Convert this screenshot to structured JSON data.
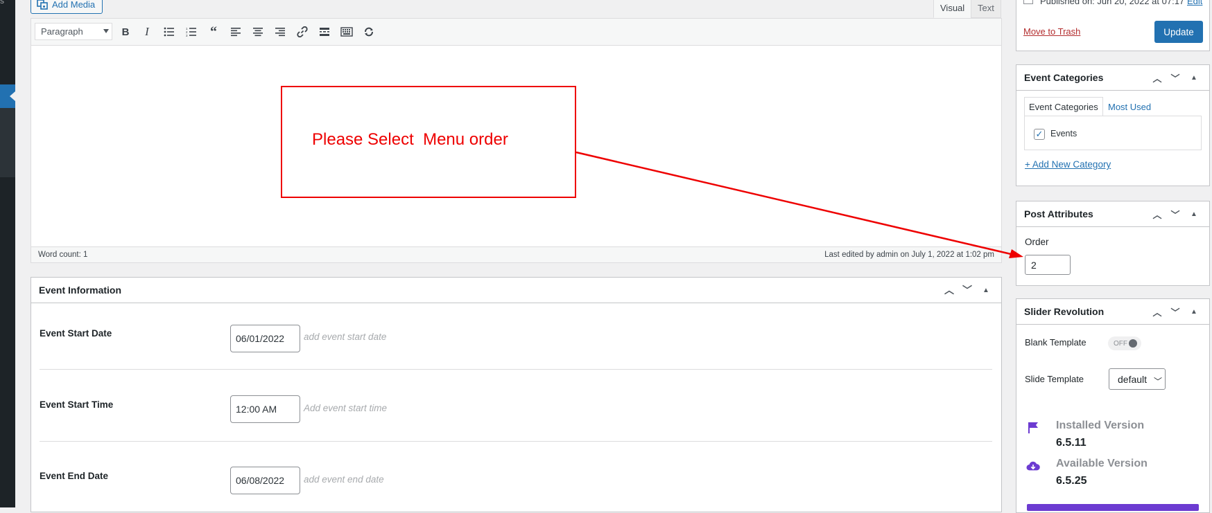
{
  "admin_menu": {
    "letter": "s"
  },
  "editor": {
    "add_media_label": "Add Media",
    "tabs": [
      {
        "label": "Visual"
      },
      {
        "label": "Text"
      }
    ],
    "format_select": "Paragraph",
    "toolbar_icons": [
      "bold-icon",
      "italic-icon",
      "bulleted-list-icon",
      "numbered-list-icon",
      "blockquote-icon",
      "align-left-icon",
      "align-center-icon",
      "align-right-icon",
      "link-icon",
      "read-more-icon",
      "toolbar-toggle-icon",
      "revisions-icon"
    ],
    "word_count": "Word count: 1",
    "last_edited": "Last edited by admin on July 1, 2022 at 1:02 pm"
  },
  "annotation": {
    "text": "Please Select  Menu order",
    "color": "#ff0000"
  },
  "event_info": {
    "title": "Event Information",
    "rows": [
      {
        "label": "Event Start Date",
        "value": "06/01/2022",
        "hint": "add event start date"
      },
      {
        "label": "Event Start Time",
        "value": "12:00 AM",
        "hint": "Add event start time"
      },
      {
        "label": "Event End Date",
        "value": "06/08/2022",
        "hint": "add event end date"
      }
    ]
  },
  "publish": {
    "published_text": "Published on: Jun 20, 2022 at 07:17",
    "edit_link": "Edit",
    "trash_label": "Move to Trash",
    "update_label": "Update"
  },
  "event_categories": {
    "title": "Event Categories",
    "tab_all": "Event Categories",
    "tab_used": "Most Used",
    "items": [
      {
        "label": "Events",
        "checked": true
      }
    ],
    "add_new": "+ Add New Category"
  },
  "post_attributes": {
    "title": "Post Attributes",
    "order_label": "Order",
    "order_value": "2"
  },
  "slider_revolution": {
    "title": "Slider Revolution",
    "blank_template_label": "Blank Template",
    "toggle_state": "OFF",
    "slide_template_label": "Slide Template",
    "slide_template_value": "default",
    "installed_label": "Installed Version",
    "installed_version": "6.5.11",
    "available_label": "Available Version",
    "available_version": "6.5.25",
    "accent_color": "#6c3bd1"
  },
  "colors": {
    "primary": "#2271b1",
    "danger": "#b32d2e",
    "admin_bg": "#1d2327"
  }
}
